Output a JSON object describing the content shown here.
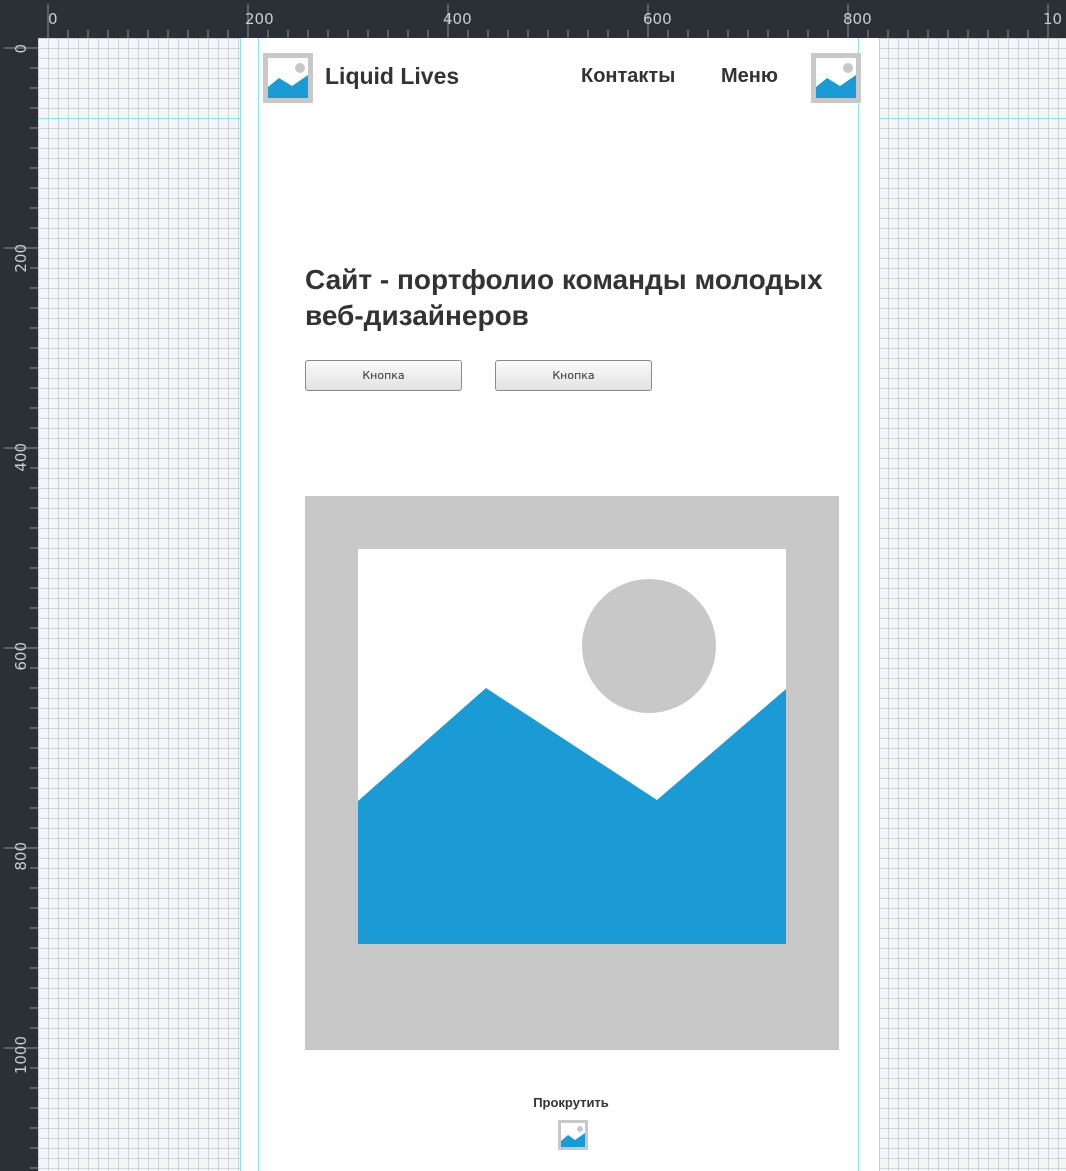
{
  "ruler": {
    "top_labels": [
      "0",
      "200",
      "400",
      "600",
      "800",
      "10"
    ],
    "left_labels": [
      "0",
      "200",
      "400",
      "600",
      "800",
      "1000"
    ]
  },
  "header": {
    "brand": "Liquid Lives",
    "nav_contacts": "Контакты",
    "nav_menu": "Меню"
  },
  "hero": {
    "title": "Сайт - портфолио команды молодых веб-дизайнеров",
    "button_1": "Кнопка",
    "button_2": "Кнопка"
  },
  "footer": {
    "scroll_label": "Прокрутить"
  },
  "colors": {
    "accent": "#1a9bd6",
    "placeholder_gray": "#c8c8c8",
    "guide": "#8fe1f0"
  },
  "icons": {
    "logo": "image-placeholder-icon",
    "menu": "image-placeholder-icon",
    "scroll": "image-placeholder-icon"
  }
}
